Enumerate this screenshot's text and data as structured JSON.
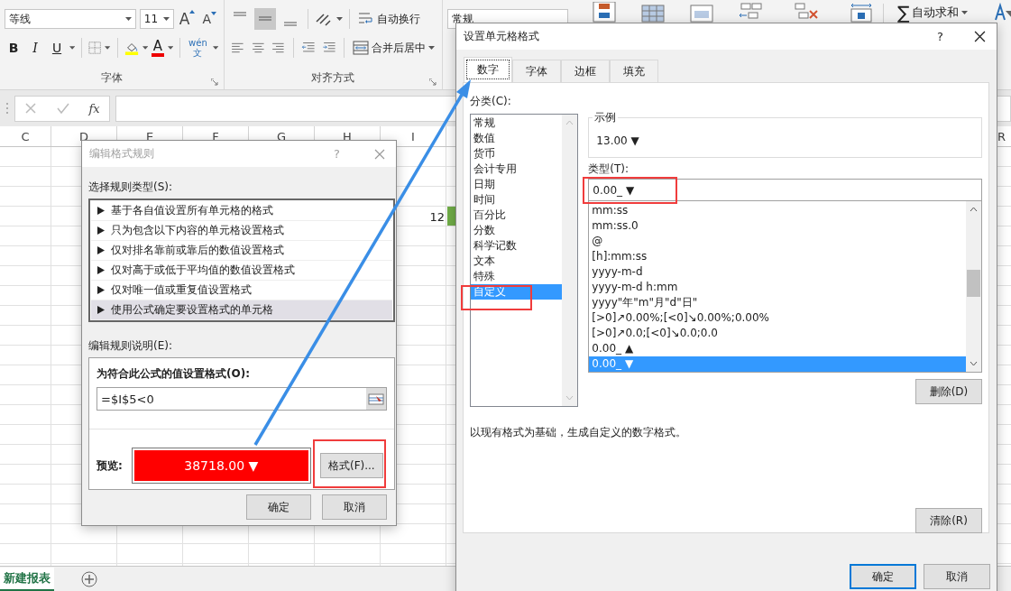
{
  "ribbon": {
    "font_name": "等线",
    "font_size": "11",
    "grow_font": "A",
    "shrink_font": "A",
    "style_buttons": [
      "B",
      "I",
      "U"
    ],
    "font_color": "A",
    "phonetic_top": "wén",
    "phonetic_bottom": "文",
    "font_group": "字体",
    "vertical_align": [
      {
        "kind": "top",
        "selected": false
      },
      {
        "kind": "middle",
        "selected": true
      },
      {
        "kind": "bottom",
        "selected": false
      }
    ],
    "wrap_text": "自动换行",
    "merge_center": "合并后居中",
    "align_group": "对齐方式",
    "number_format": "常规",
    "sum_symbol": "∑",
    "autosum": "自动求和"
  },
  "formula_bar": {
    "function_label": "fx"
  },
  "sheet": {
    "columns": [
      "C",
      "D",
      "E",
      "F",
      "G",
      "H",
      "I"
    ],
    "edge_column": "R",
    "value_cell": "12"
  },
  "sheet_tabs": [
    {
      "label": "新建报表",
      "selected": true
    }
  ],
  "rule_dialog": {
    "title": "编辑格式规则",
    "help": "?",
    "type_label": "选择规则类型(S):",
    "rule_types": [
      {
        "label": "基于各自值设置所有单元格的格式",
        "selected": false
      },
      {
        "label": "只为包含以下内容的单元格设置格式",
        "selected": false
      },
      {
        "label": "仅对排名靠前或靠后的数值设置格式",
        "selected": false
      },
      {
        "label": "仅对高于或低于平均值的数值设置格式",
        "selected": false
      },
      {
        "label": "仅对唯一值或重复值设置格式",
        "selected": false
      },
      {
        "label": "使用公式确定要设置格式的单元格",
        "selected": true
      }
    ],
    "description_label": "编辑规则说明(E):",
    "formula_label": "为符合此公式的值设置格式(O):",
    "formula": "=$I$5<0",
    "preview_label": "预览:",
    "preview": "38718.00 ▼",
    "format_button": "格式(F)...",
    "buttons": [
      "确定",
      "取消"
    ]
  },
  "format_dialog": {
    "title": "设置单元格格式",
    "help": "?",
    "tabs": [
      {
        "label": "数字",
        "selected": true
      },
      {
        "label": "字体",
        "selected": false
      },
      {
        "label": "边框",
        "selected": false
      },
      {
        "label": "填充",
        "selected": false
      }
    ],
    "category_label": "分类(C):",
    "categories": [
      {
        "label": "常规",
        "selected": false
      },
      {
        "label": "数值",
        "selected": false
      },
      {
        "label": "货币",
        "selected": false
      },
      {
        "label": "会计专用",
        "selected": false
      },
      {
        "label": "日期",
        "selected": false
      },
      {
        "label": "时间",
        "selected": false
      },
      {
        "label": "百分比",
        "selected": false
      },
      {
        "label": "分数",
        "selected": false
      },
      {
        "label": "科学记数",
        "selected": false
      },
      {
        "label": "文本",
        "selected": false
      },
      {
        "label": "特殊",
        "selected": false
      },
      {
        "label": "自定义",
        "selected": true
      }
    ],
    "sample_label": "示例",
    "sample": "13.00 ▼",
    "type_label": "类型(T):",
    "type_value": "0.00_ ▼",
    "types": [
      {
        "label": "mm:ss",
        "selected": false
      },
      {
        "label": "mm:ss.0",
        "selected": false
      },
      {
        "label": "@",
        "selected": false
      },
      {
        "label": "[h]:mm:ss",
        "selected": false
      },
      {
        "label": "yyyy-m-d",
        "selected": false
      },
      {
        "label": "yyyy-m-d h:mm",
        "selected": false
      },
      {
        "label": "yyyy\"年\"m\"月\"d\"日\"",
        "selected": false
      },
      {
        "label": "[>0]↗0.00%;[<0]↘0.00%;0.00%",
        "selected": false
      },
      {
        "label": "[>0]↗0.0;[<0]↘0.0;0.0",
        "selected": false
      },
      {
        "label": "0.00_ ▲",
        "selected": false
      },
      {
        "label": "0.00_ ▼",
        "selected": true
      }
    ],
    "delete_button": "删除(D)",
    "description": "以现有格式为基础，生成自定义的数字格式。",
    "clear_button": "清除(R)",
    "buttons": [
      "确定",
      "取消"
    ]
  }
}
